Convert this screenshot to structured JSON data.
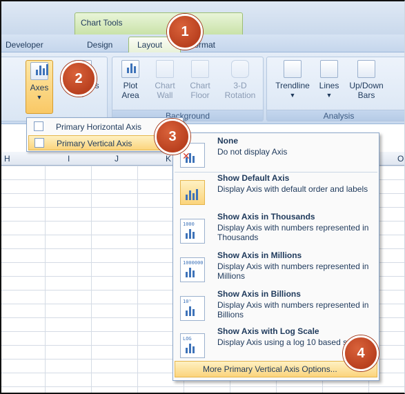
{
  "header": {
    "context_title": "Chart Tools"
  },
  "tabs": {
    "developer": "Developer",
    "design": "Design",
    "layout": "Layout",
    "format": "Format"
  },
  "ribbon": {
    "axes": "Axes",
    "gridlines": "Gridlines",
    "plot_area": "Plot Area",
    "chart_wall": "Chart Wall",
    "chart_floor": "Chart Floor",
    "rotation": "3-D Rotation",
    "background_group": "Background",
    "trendline": "Trendline",
    "lines": "Lines",
    "updown": "Up/Down Bars",
    "analysis_group": "Analysis"
  },
  "axes_menu": [
    {
      "label": "Primary Horizontal Axis",
      "selected": false
    },
    {
      "label": "Primary Vertical Axis",
      "selected": true
    }
  ],
  "columns": [
    "H",
    "I",
    "J",
    "K",
    "O"
  ],
  "vertical_axis_menu": [
    {
      "title": "None",
      "desc": "Do not display Axis",
      "icon": "no-axis-icon",
      "highlight": false,
      "tag": ""
    },
    {
      "title": "Show Default Axis",
      "desc": "Display Axis with default order and labels",
      "icon": "default-axis-icon",
      "highlight": true,
      "tag": ""
    },
    {
      "title": "Show Axis in Thousands",
      "desc": "Display Axis with numbers represented in Thousands",
      "icon": "thousands-axis-icon",
      "highlight": false,
      "tag": "1000"
    },
    {
      "title": "Show Axis in Millions",
      "desc": "Display Axis with numbers represented in Millions",
      "icon": "millions-axis-icon",
      "highlight": false,
      "tag": "1000000"
    },
    {
      "title": "Show Axis in Billions",
      "desc": "Display Axis with numbers represented in Billions",
      "icon": "billions-axis-icon",
      "highlight": false,
      "tag": "10⁹"
    },
    {
      "title": "Show Axis with Log Scale",
      "desc": "Display Axis using a log 10 based scale",
      "icon": "log-axis-icon",
      "highlight": false,
      "tag": "LOG"
    }
  ],
  "more_options": "More Primary Vertical Axis Options...",
  "callouts": [
    "1",
    "2",
    "3",
    "4"
  ],
  "colors": {
    "accent_orange": "#c1492a",
    "highlight": "#fbd47c",
    "ribbon_blue": "#d6e3f3"
  }
}
